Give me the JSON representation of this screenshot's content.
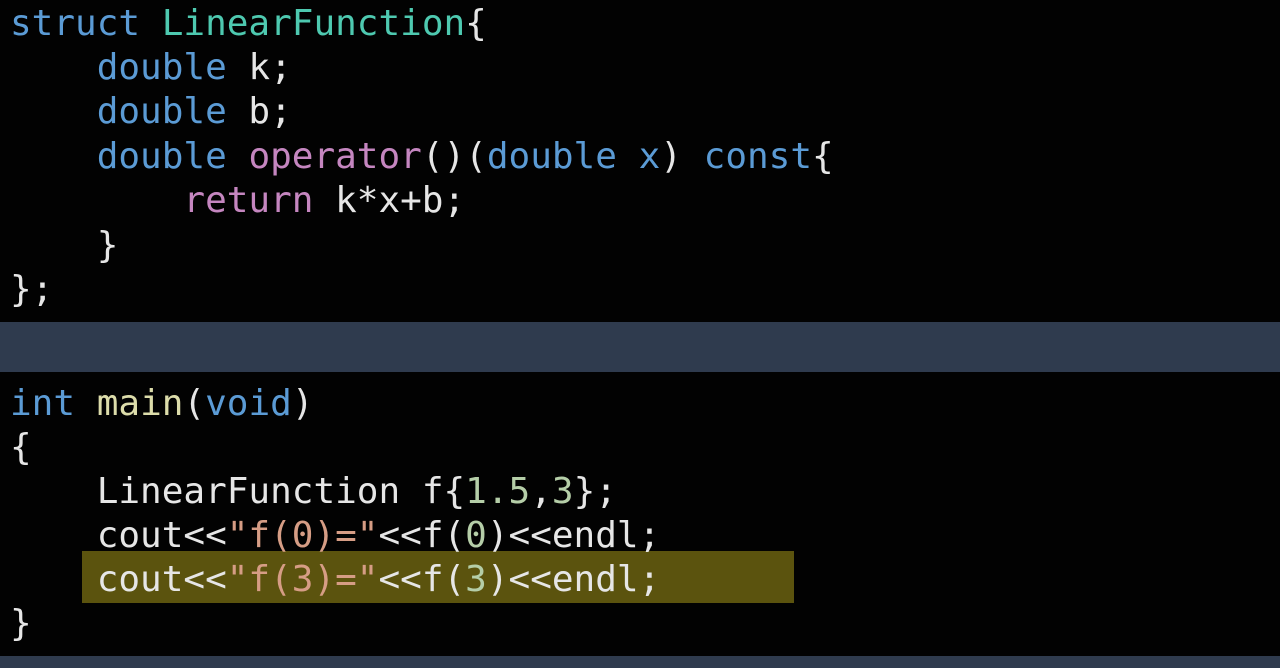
{
  "colors": {
    "background": "#020202",
    "divider": "#2f3b4e",
    "highlight": "#5b530e",
    "keyword": "#5b9bd5",
    "control_keyword": "#c586c0",
    "type_name": "#4ec9b0",
    "function_name": "#dcdcaa",
    "number": "#b5cea8",
    "string": "#d69d85",
    "text": "#e6e6e6"
  },
  "top_code": {
    "line1": {
      "kw": "struct",
      "sp": " ",
      "type": "LinearFunction",
      "rest": "{"
    },
    "line2": {
      "indent": "    ",
      "kw": "double",
      "rest": " k;"
    },
    "line3": {
      "indent": "    ",
      "kw": "double",
      "rest": " b;"
    },
    "line4": {
      "indent": "    ",
      "kw1": "double",
      "sp1": " ",
      "op": "operator",
      "paren": "()(",
      "kw2": "double",
      "sp2": " ",
      "param": "x",
      "paren2": ") ",
      "kw3": "const",
      "brace": "{"
    },
    "line5": {
      "indent": "        ",
      "kw": "return",
      "rest": " k*x+b;"
    },
    "line6": {
      "indent": "    ",
      "rest": "}"
    },
    "line7": {
      "rest": "};"
    }
  },
  "bottom_code": {
    "line1": {
      "kw": "int",
      "sp": " ",
      "fn": "main",
      "p1": "(",
      "kw2": "void",
      "p2": ")"
    },
    "line2": {
      "rest": "{"
    },
    "line3": {
      "indent": "    ",
      "type": "LinearFunction",
      "mid": " f{",
      "num1": "1.5",
      "comma": ",",
      "num2": "3",
      "end": "};"
    },
    "line4": {
      "indent": "    ",
      "pre": "cout<<",
      "str": "\"f(0)=\"",
      "mid": "<<f(",
      "num": "0",
      "end": ")<<endl;"
    },
    "line5": {
      "indent": "    ",
      "pre": "cout<<",
      "str": "\"f(3)=\"",
      "mid": "<<f(",
      "num": "3",
      "end": ")<<endl;"
    },
    "line6": {
      "rest": "}"
    }
  }
}
